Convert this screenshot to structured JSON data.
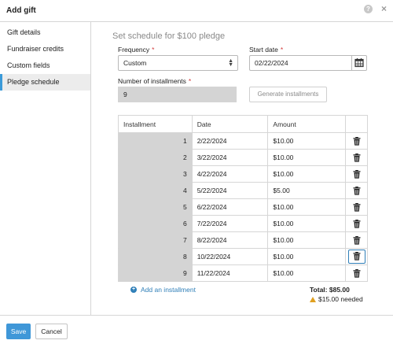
{
  "dialog": {
    "title": "Add gift"
  },
  "sidebar": {
    "items": [
      {
        "label": "Gift details"
      },
      {
        "label": "Fundraiser credits"
      },
      {
        "label": "Custom fields"
      },
      {
        "label": "Pledge schedule",
        "active": true
      }
    ]
  },
  "form": {
    "section_title": "Set schedule for $100 pledge",
    "required_marker": "*",
    "frequency": {
      "label": "Frequency",
      "value": "Custom"
    },
    "start_date": {
      "label": "Start date",
      "value": "02/22/2024"
    },
    "installments": {
      "label": "Number of installments",
      "value": "9"
    },
    "generate_label": "Generate installments"
  },
  "table": {
    "headers": [
      "Installment",
      "Date",
      "Amount"
    ],
    "rows": [
      {
        "num": "1",
        "date": "2/22/2024",
        "amount": "$10.00"
      },
      {
        "num": "2",
        "date": "3/22/2024",
        "amount": "$10.00"
      },
      {
        "num": "3",
        "date": "4/22/2024",
        "amount": "$10.00"
      },
      {
        "num": "4",
        "date": "5/22/2024",
        "amount": "$5.00"
      },
      {
        "num": "5",
        "date": "6/22/2024",
        "amount": "$10.00"
      },
      {
        "num": "6",
        "date": "7/22/2024",
        "amount": "$10.00"
      },
      {
        "num": "7",
        "date": "8/22/2024",
        "amount": "$10.00"
      },
      {
        "num": "8",
        "date": "10/22/2024",
        "amount": "$10.00",
        "focused": true
      },
      {
        "num": "9",
        "date": "11/22/2024",
        "amount": "$10.00"
      }
    ]
  },
  "add_installment_label": "Add an installment",
  "totals": {
    "total": "Total: $85.00",
    "needed": "$15.00 needed"
  },
  "footer": {
    "save_label": "Save",
    "cancel_label": "Cancel"
  },
  "colors": {
    "accent": "#3f97d8",
    "link": "#2f7fb8",
    "warning": "#e0a020",
    "required": "#d23b3b"
  }
}
